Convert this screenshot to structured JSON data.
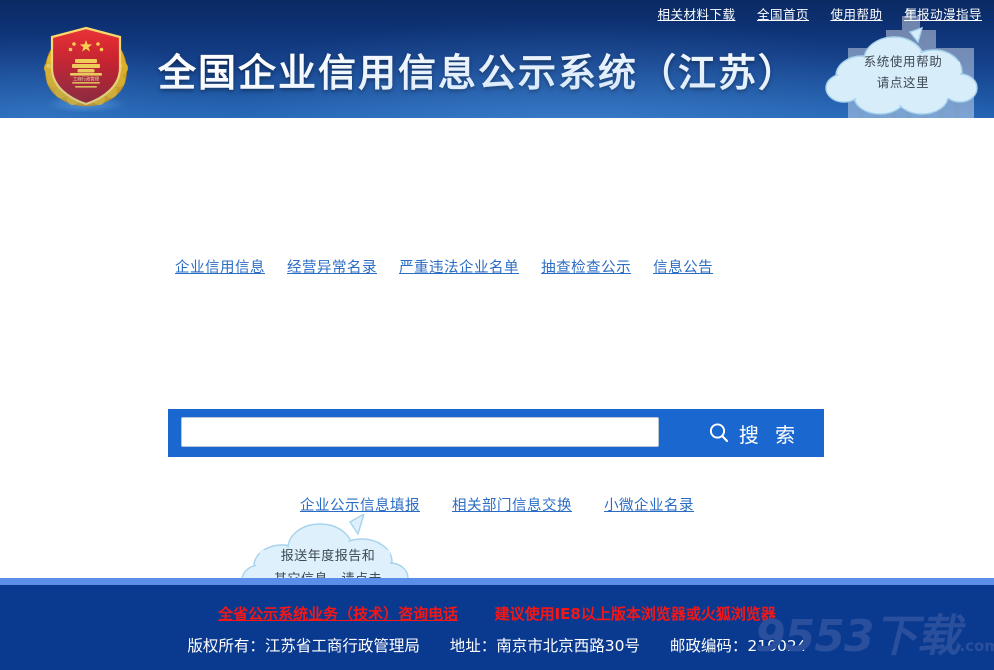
{
  "colors": {
    "header_dark": "#0a2a63",
    "header_light": "#2465b4",
    "link_blue": "#2b6cc4",
    "search_blue": "#1b67d0",
    "footer_navy": "#0a3a8f",
    "footer_topline": "#5b8ee8",
    "footer_red": "#f51616",
    "cloud_fill": "#d8edfa",
    "cloud_stroke": "#a8d5ee",
    "emblem_red": "#c8161d",
    "emblem_gold": "#f2c118"
  },
  "header": {
    "title": "全国企业信用信息公示系统（江苏）",
    "emblem_name": "national-emblem",
    "topnav": [
      {
        "label": "相关材料下载"
      },
      {
        "label": "全国首页"
      },
      {
        "label": "使用帮助"
      },
      {
        "label": "年报动漫指导"
      }
    ],
    "help_cloud": {
      "line1": "系统使用帮助",
      "line2": "请点这里"
    }
  },
  "main": {
    "tabs": [
      {
        "label": "企业信用信息"
      },
      {
        "label": "经营异常名录"
      },
      {
        "label": "严重违法企业名单"
      },
      {
        "label": "抽查检查公示"
      },
      {
        "label": "信息公告"
      }
    ],
    "search": {
      "value": "",
      "placeholder": "",
      "button_label": "搜 索",
      "icon": "search-icon"
    },
    "secondary_links": [
      {
        "label": "企业公示信息填报"
      },
      {
        "label": "相关部门信息交换"
      },
      {
        "label": "小微企业名录"
      }
    ],
    "report_cloud": {
      "line1": "报送年度报告和",
      "line2": "其它信息，请点击"
    }
  },
  "footer": {
    "hotline_link": "全省公示系统业务（技术）咨询电话",
    "browser_notice": "建议使用IE8以上版本浏览器或火狐浏览器",
    "copyright": "版权所有：江苏省工商行政管理局",
    "address": "地址：南京市北京西路30号",
    "postcode": "邮政编码：210024",
    "watermark": "9553下载",
    "watermark_domain": ".com"
  }
}
